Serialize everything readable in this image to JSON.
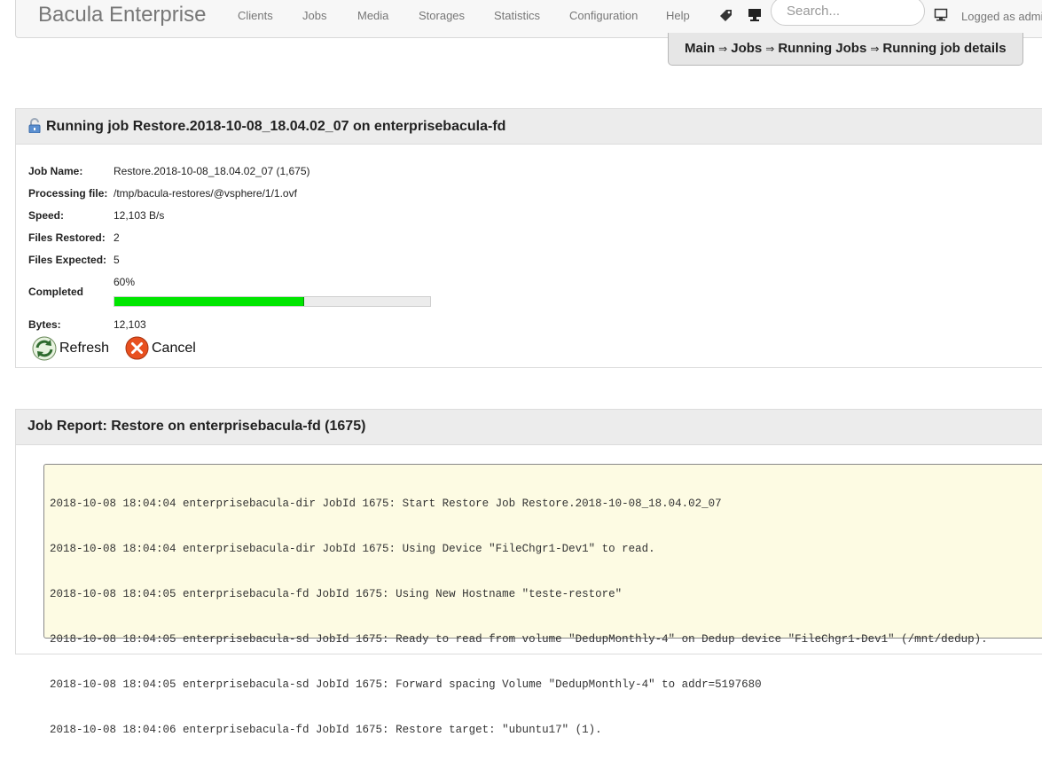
{
  "header": {
    "brand": "Bacula Enterprise",
    "nav": [
      "Clients",
      "Jobs",
      "Media",
      "Storages",
      "Statistics",
      "Configuration",
      "Help"
    ],
    "search_placeholder": "Search...",
    "logged_in": "Logged as admin"
  },
  "breadcrumb": {
    "items": [
      "Main",
      "Jobs",
      "Running Jobs",
      "Running job details"
    ],
    "separator": "⇒"
  },
  "running_job": {
    "title": "Running job Restore.2018-10-08_18.04.02_07 on enterprisebacula-fd",
    "fields": {
      "job_name_label": "Job Name:",
      "job_name": "Restore.2018-10-08_18.04.02_07 (1,675)",
      "processing_file_label": "Processing file:",
      "processing_file": "/tmp/bacula-restores/@vsphere/1/1.ovf",
      "speed_label": "Speed:",
      "speed": "12,103 B/s",
      "files_restored_label": "Files Restored:",
      "files_restored": "2",
      "files_expected_label": "Files  Expected:",
      "files_expected": "5",
      "completed_label": "Completed",
      "completed_text": "60%",
      "completed_fraction": 0.6,
      "bytes_label": "Bytes:",
      "bytes": "12,103"
    },
    "buttons": {
      "refresh": "Refresh",
      "cancel": "Cancel"
    }
  },
  "job_report": {
    "title": "Job Report: Restore on enterprisebacula-fd (1675)",
    "log_lines": [
      "2018-10-08 18:04:04 enterprisebacula-dir JobId 1675: Start Restore Job Restore.2018-10-08_18.04.02_07",
      "2018-10-08 18:04:04 enterprisebacula-dir JobId 1675: Using Device \"FileChgr1-Dev1\" to read.",
      "2018-10-08 18:04:05 enterprisebacula-fd JobId 1675: Using New Hostname \"teste-restore\"",
      "2018-10-08 18:04:05 enterprisebacula-sd JobId 1675: Ready to read from volume \"DedupMonthly-4\" on Dedup device \"FileChgr1-Dev1\" (/mnt/dedup).",
      "2018-10-08 18:04:05 enterprisebacula-sd JobId 1675: Forward spacing Volume \"DedupMonthly-4\" to addr=5197680",
      "2018-10-08 18:04:06 enterprisebacula-fd JobId 1675: Restore target: \"ubuntu17\" (1)."
    ]
  },
  "colors": {
    "progress_fill": "#00e600",
    "log_background": "#fdfbe3",
    "header_background": "#ececec"
  },
  "icons": {
    "lock": "open-lock-icon",
    "refresh": "refresh-icon",
    "cancel": "cancel-icon",
    "tag": "tag-icon",
    "monitor": "monitor-icon",
    "user_monitor": "computer-icon"
  }
}
